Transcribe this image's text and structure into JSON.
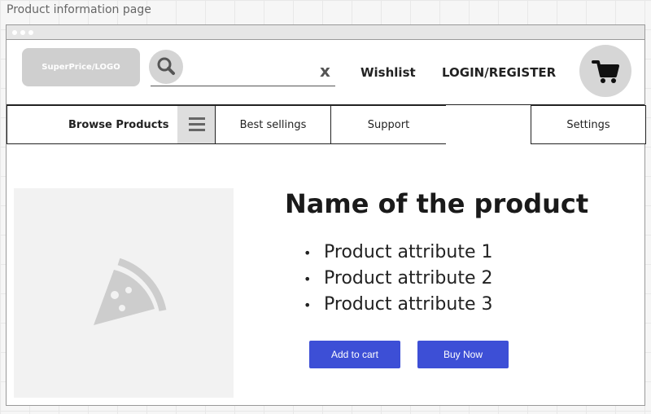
{
  "canvas": {
    "page_label": "Product information page"
  },
  "header": {
    "logo_text": "SuperPrice/LOGO",
    "search": {
      "value": "",
      "placeholder": "",
      "clear_label": "x"
    },
    "wishlist_label": "Wishlist",
    "login_label": "LOGIN/REGISTER"
  },
  "menu": {
    "browse_label": "Browse Products",
    "items": [
      {
        "label": "Best sellings"
      },
      {
        "label": "Support"
      },
      {
        "label": ""
      },
      {
        "label": "Settings"
      }
    ]
  },
  "product": {
    "name": "Name of the product",
    "attributes": [
      "Product attribute 1",
      "Product attribute 2",
      "Product attribute 3"
    ],
    "bullet": "•"
  },
  "actions": {
    "add_to_cart_label": "Add to cart",
    "buy_now_label": "Buy Now"
  },
  "icons": {
    "search": "search-icon",
    "menu": "hamburger-icon",
    "cart": "cart-icon",
    "image_placeholder": "pizza-slice-icon"
  },
  "colors": {
    "primary_button": "#3d4fd6",
    "logo_bg": "#cfcfcf",
    "text": "#222222"
  }
}
